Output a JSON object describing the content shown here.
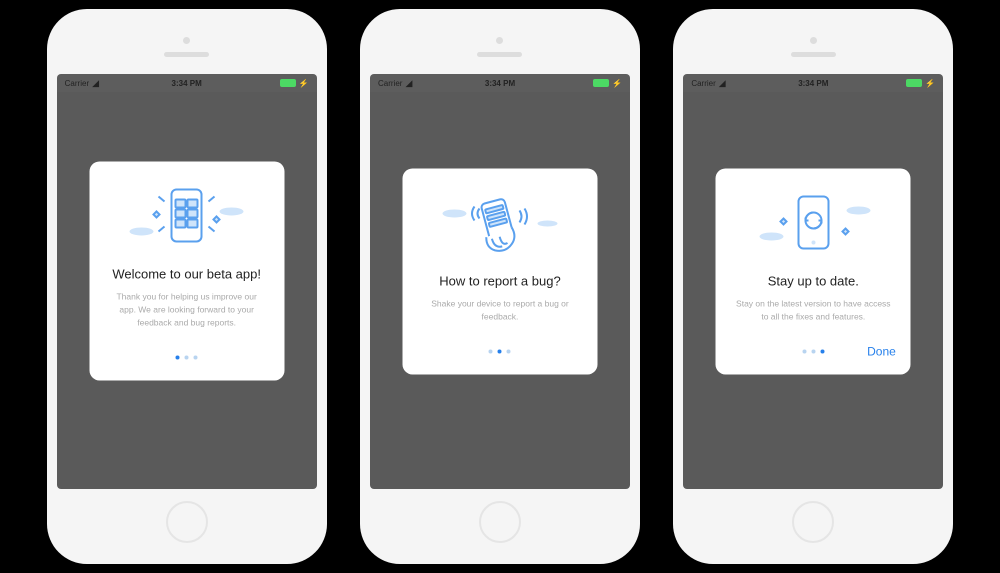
{
  "statusBar": {
    "carrier": "Carrier",
    "time": "3:34 PM"
  },
  "screens": [
    {
      "illustration": "welcome-phone-icon",
      "title": "Welcome to our beta app!",
      "body": "Thank you for helping us improve our app. We are looking forward to your feedback and bug reports.",
      "activeDot": 0,
      "showDone": false
    },
    {
      "illustration": "shake-phone-icon",
      "title": "How to report a bug?",
      "body": "Shake your device to report a bug or feedback.",
      "activeDot": 1,
      "showDone": false
    },
    {
      "illustration": "sync-phone-icon",
      "title": "Stay up to date.",
      "body": "Stay on the latest version to have access to all the fixes and features.",
      "activeDot": 2,
      "showDone": true,
      "doneLabel": "Done"
    }
  ],
  "colors": {
    "accent": "#2680eb",
    "illustrationStroke": "#5aa0ee",
    "illustrationFill": "#cfe4fa"
  }
}
